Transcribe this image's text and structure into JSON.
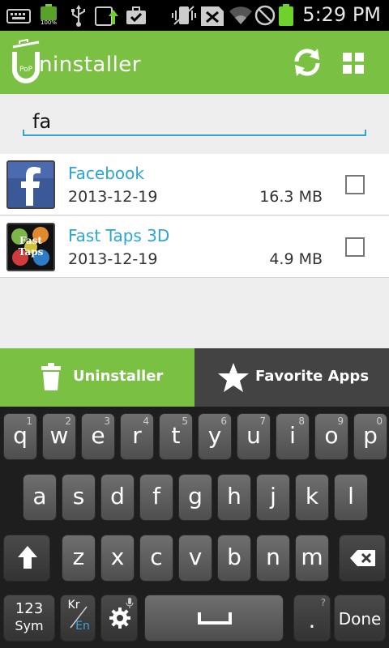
{
  "status_bar": {
    "battery_small_percent": "100%",
    "time": "5:29 PM"
  },
  "app": {
    "logo_text": "ninstaller",
    "logo_badge": "PoP",
    "icons": [
      "refresh-icon",
      "grid-icon"
    ]
  },
  "search": {
    "value": "fa",
    "placeholder": ""
  },
  "apps": [
    {
      "name": "Facebook",
      "date": "2013-12-19",
      "size": "16.3 MB",
      "checked": false
    },
    {
      "name": "Fast Taps 3D",
      "date": "2013-12-19",
      "size": "4.9 MB",
      "checked": false
    }
  ],
  "fasttaps_icon_text": [
    "Fast",
    "Taps"
  ],
  "tabs": {
    "uninstaller": "Uninstaller",
    "favorite": "Favorite Apps"
  },
  "keyboard": {
    "row1": [
      {
        "k": "q",
        "n": "1"
      },
      {
        "k": "w",
        "n": "2"
      },
      {
        "k": "e",
        "n": "3"
      },
      {
        "k": "r",
        "n": "4"
      },
      {
        "k": "t",
        "n": "5"
      },
      {
        "k": "y",
        "n": "6"
      },
      {
        "k": "u",
        "n": "7"
      },
      {
        "k": "i",
        "n": "8"
      },
      {
        "k": "o",
        "n": "9"
      },
      {
        "k": "p",
        "n": "0"
      }
    ],
    "row2": [
      "a",
      "s",
      "d",
      "f",
      "g",
      "h",
      "j",
      "k",
      "l"
    ],
    "row3": [
      "z",
      "x",
      "c",
      "v",
      "b",
      "n",
      "m"
    ],
    "sym_top": "123",
    "sym_bottom": "Sym",
    "lang_top": "Kr",
    "lang_bottom": "En",
    "period": ".",
    "period_hint": "?",
    "done": "Done"
  },
  "colors": {
    "brand_green": "#7ac143",
    "link_blue": "#2aa6d6",
    "dark_tab": "#434343"
  }
}
